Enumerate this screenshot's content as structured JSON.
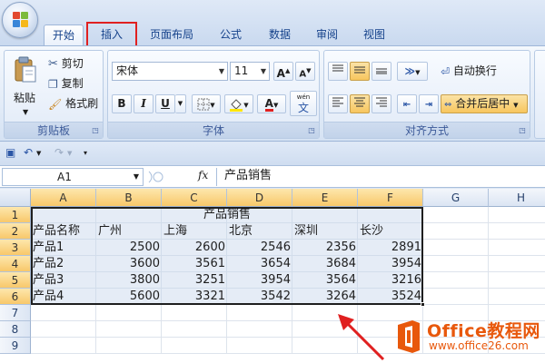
{
  "tabs": [
    {
      "label": "开始",
      "active": true
    },
    {
      "label": "插入",
      "highlighted": true
    },
    {
      "label": "页面布局"
    },
    {
      "label": "公式"
    },
    {
      "label": "数据"
    },
    {
      "label": "审阅"
    },
    {
      "label": "视图"
    }
  ],
  "ribbon": {
    "clipboard": {
      "label": "剪贴板",
      "paste": "粘贴",
      "cut": "剪切",
      "copy": "复制",
      "format_painter": "格式刷"
    },
    "font": {
      "label": "字体",
      "font_name": "宋体",
      "font_size": "11",
      "bold": "B",
      "italic": "I",
      "underline": "U",
      "grow": "A",
      "shrink": "A",
      "phonetic": "wén",
      "phonetic_char": "文"
    },
    "alignment": {
      "label": "对齐方式",
      "wrap_text": "自动换行",
      "merge_center": "合并后居中"
    }
  },
  "formula_bar": {
    "name_box": "A1",
    "fx": "fx",
    "content": "产品销售"
  },
  "sheet": {
    "columns": [
      "A",
      "B",
      "C",
      "D",
      "E",
      "F",
      "G",
      "H"
    ],
    "rows": [
      "1",
      "2",
      "3",
      "4",
      "5",
      "6",
      "7",
      "8",
      "9"
    ],
    "title": "产品销售",
    "headers": [
      "产品名称",
      "广州",
      "上海",
      "北京",
      "深圳",
      "长沙"
    ],
    "data": [
      [
        "产品1",
        "2500",
        "2600",
        "2546",
        "2356",
        "2891"
      ],
      [
        "产品2",
        "3600",
        "3561",
        "3654",
        "3684",
        "3954"
      ],
      [
        "产品3",
        "3800",
        "3251",
        "3954",
        "3564",
        "3216"
      ],
      [
        "产品4",
        "5600",
        "3321",
        "3542",
        "3264",
        "3524"
      ]
    ]
  },
  "watermark": {
    "brand": "Office教程网",
    "url": "www.office26.com"
  },
  "colors": {
    "accent_red": "#e02020",
    "brand_orange": "#e8580c",
    "selection_header": "#f8c86a"
  }
}
